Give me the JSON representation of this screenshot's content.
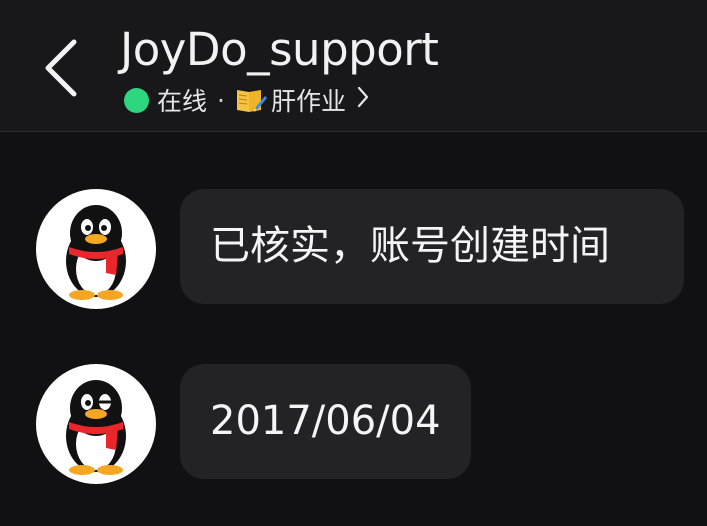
{
  "header": {
    "title": "JoyDo_support",
    "status": "在线",
    "separator": "·",
    "activity": "肝作业",
    "icons": {
      "back": "back-arrow-icon",
      "online": "online-status-dot-icon",
      "activity": "book-pencil-icon",
      "more": "chevron-right-icon"
    }
  },
  "messages": [
    {
      "sender": "support",
      "avatar_icon": "qq-penguin-avatar",
      "text": "已核实，账号创建时间"
    },
    {
      "sender": "support",
      "avatar_icon": "qq-penguin-avatar",
      "text": "2017/06/04"
    }
  ],
  "colors": {
    "background": "#111114",
    "header": "#18181b",
    "bubble": "#232326",
    "online": "#2ed67f",
    "scarf": "#e8262c",
    "beak": "#f5a623"
  }
}
